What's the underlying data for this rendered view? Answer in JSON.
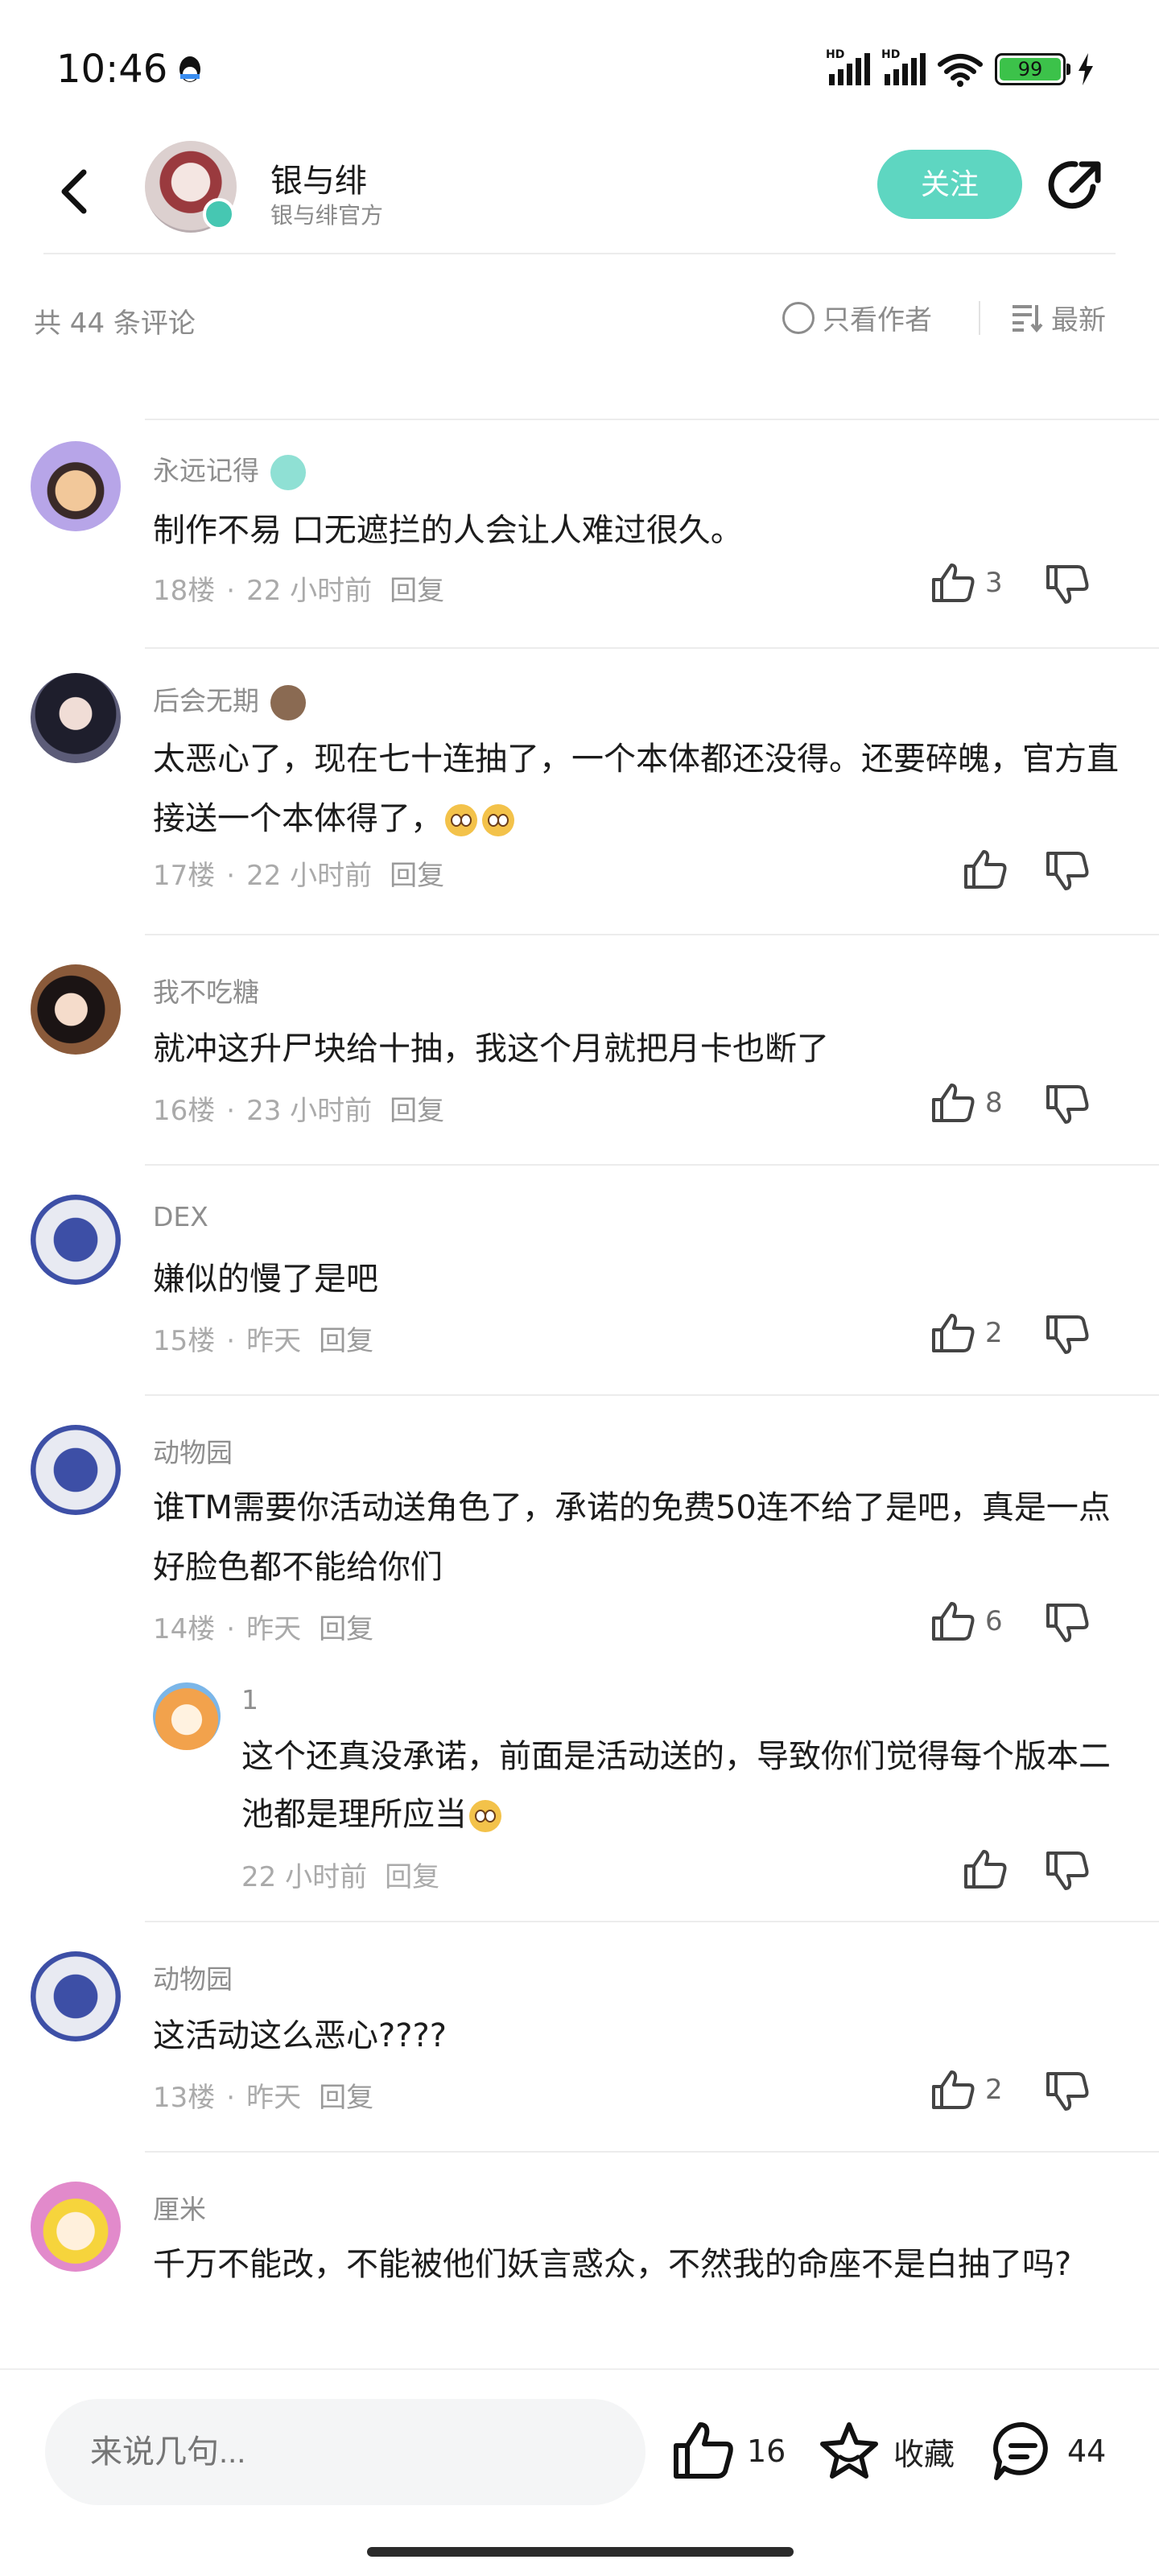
{
  "status": {
    "time": "10:46",
    "battery": "99"
  },
  "header": {
    "name": "银与绯",
    "subtitle": "银与绯官方",
    "follow_label": "关注"
  },
  "countbar": {
    "total": "共 44 条评论",
    "only_author": "只看作者",
    "sort": "最新"
  },
  "comments": [
    {
      "name": "永远记得",
      "text": "制作不易 口无遮拦的人会让人难过很久。",
      "floor": "18楼",
      "time": "22 小时前",
      "reply": "回复",
      "likes": "3"
    },
    {
      "name": "后会无期",
      "text": "太恶心了，现在七十连抽了，一个本体都还没得。还要碎魄，官方直接送一个本体得了，",
      "floor": "17楼",
      "time": "22 小时前",
      "reply": "回复",
      "likes": ""
    },
    {
      "name": "我不吃糖",
      "text": "就冲这升尸块给十抽，我这个月就把月卡也断了",
      "floor": "16楼",
      "time": "23 小时前",
      "reply": "回复",
      "likes": "8"
    },
    {
      "name": "DEX",
      "text": "嫌似的慢了是吧",
      "floor": "15楼",
      "time": "昨天",
      "reply": "回复",
      "likes": "2"
    },
    {
      "name": "动物园",
      "text": "谁TM需要你活动送角色了，承诺的免费50连不给了是吧，真是一点好脸色都不能给你们",
      "floor": "14楼",
      "time": "昨天",
      "reply": "回复",
      "likes": "6",
      "sub": {
        "name": "1",
        "text": "这个还真没承诺，前面是活动送的，导致你们觉得每个版本二池都是理所应当",
        "time": "22 小时前",
        "reply": "回复"
      }
    },
    {
      "name": "动物园",
      "text": "这活动这么恶心????",
      "floor": "13楼",
      "time": "昨天",
      "reply": "回复",
      "likes": "2"
    },
    {
      "name": "厘米",
      "text": "千万不能改，不能被他们妖言惑众，不然我的命座不是白抽了吗?",
      "floor": "",
      "time": "",
      "reply": "",
      "likes": ""
    }
  ],
  "bottom": {
    "placeholder": "来说几句...",
    "likes": "16",
    "favorite": "收藏",
    "comments": "44"
  },
  "colors": {
    "accent": "#5ed6c1",
    "muted": "#8e8e8e"
  }
}
